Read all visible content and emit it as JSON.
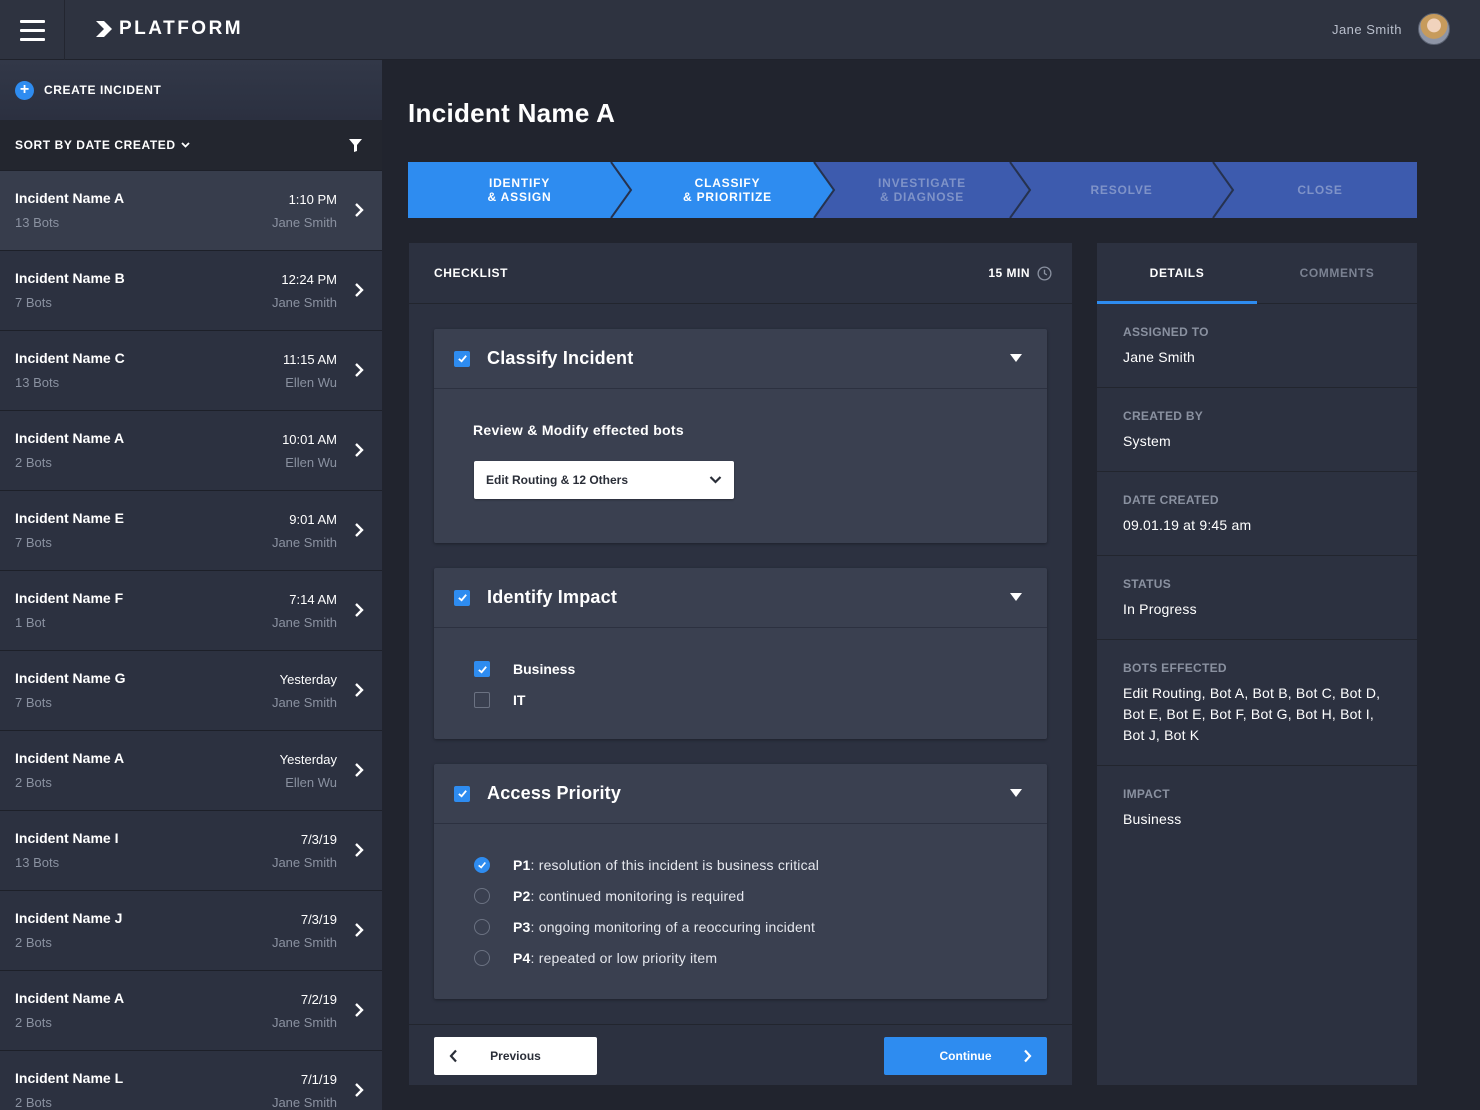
{
  "app": {
    "brand": "PLATFORM",
    "user_name": "Jane Smith",
    "accent": "#2e8cf0"
  },
  "sidebar": {
    "create_label": "CREATE INCIDENT",
    "sort_label": "SORT BY DATE CREATED",
    "incidents": [
      {
        "name": "Incident Name A",
        "bots": "13 Bots",
        "time": "1:10 PM",
        "user": "Jane Smith",
        "active": true
      },
      {
        "name": "Incident Name B",
        "bots": "7 Bots",
        "time": "12:24 PM",
        "user": "Jane Smith"
      },
      {
        "name": "Incident Name C",
        "bots": "13 Bots",
        "time": "11:15 AM",
        "user": "Ellen Wu"
      },
      {
        "name": "Incident Name A",
        "bots": "2 Bots",
        "time": "10:01 AM",
        "user": "Ellen Wu"
      },
      {
        "name": "Incident Name E",
        "bots": "7 Bots",
        "time": "9:01 AM",
        "user": "Jane Smith"
      },
      {
        "name": "Incident Name F",
        "bots": "1 Bot",
        "time": "7:14 AM",
        "user": "Jane Smith"
      },
      {
        "name": "Incident Name G",
        "bots": "7 Bots",
        "time": "Yesterday",
        "user": "Jane Smith"
      },
      {
        "name": "Incident Name A",
        "bots": "2 Bots",
        "time": "Yesterday",
        "user": "Ellen Wu"
      },
      {
        "name": "Incident Name I",
        "bots": "13 Bots",
        "time": "7/3/19",
        "user": "Jane Smith"
      },
      {
        "name": "Incident Name J",
        "bots": "2 Bots",
        "time": "7/3/19",
        "user": "Jane Smith"
      },
      {
        "name": "Incident Name A",
        "bots": "2 Bots",
        "time": "7/2/19",
        "user": "Jane Smith"
      },
      {
        "name": "Incident Name L",
        "bots": "2 Bots",
        "time": "7/1/19",
        "user": "Jane Smith"
      }
    ]
  },
  "main": {
    "title": "Incident Name A",
    "steps": [
      {
        "label": "IDENTIFY\n& ASSIGN",
        "state": "done"
      },
      {
        "label": "CLASSIFY\n& PRIORITIZE",
        "state": "done"
      },
      {
        "label": "INVESTIGATE\n& DIAGNOSE",
        "state": "todo"
      },
      {
        "label": "RESOLVE",
        "state": "todo"
      },
      {
        "label": "CLOSE",
        "state": "todo"
      }
    ]
  },
  "checklist": {
    "title": "CHECKLIST",
    "time": "15 MIN",
    "classify": {
      "title": "Classify Incident",
      "subhead": "Review & Modify effected bots",
      "select_value": "Edit Routing & 12 Others"
    },
    "impact": {
      "title": "Identify Impact",
      "options": [
        {
          "label": "Business",
          "checked": true
        },
        {
          "label": "IT",
          "checked": false
        }
      ]
    },
    "priority": {
      "title": "Access Priority",
      "options": [
        {
          "code": "P1",
          "text": ": resolution of this incident is business critical",
          "checked": true
        },
        {
          "code": "P2",
          "text": ": continued monitoring is required",
          "checked": false
        },
        {
          "code": "P3",
          "text": ": ongoing monitoring of a reoccuring incident",
          "checked": false
        },
        {
          "code": "P4",
          "text": ": repeated or low priority item",
          "checked": false
        }
      ]
    },
    "prev_label": "Previous",
    "next_label": "Continue"
  },
  "details": {
    "tabs": [
      "DETAILS",
      "COMMENTS"
    ],
    "fields": [
      {
        "label": "ASSIGNED TO",
        "value": "Jane Smith"
      },
      {
        "label": "CREATED BY",
        "value": "System"
      },
      {
        "label": "DATE CREATED",
        "value": "09.01.19 at 9:45 am"
      },
      {
        "label": "STATUS",
        "value": "In Progress"
      },
      {
        "label": "BOTS EFFECTED",
        "value": "Edit Routing, Bot A, Bot B, Bot C, Bot D, Bot E, Bot E, Bot F, Bot G, Bot H, Bot I, Bot J, Bot K"
      },
      {
        "label": "IMPACT",
        "value": "Business"
      }
    ]
  }
}
